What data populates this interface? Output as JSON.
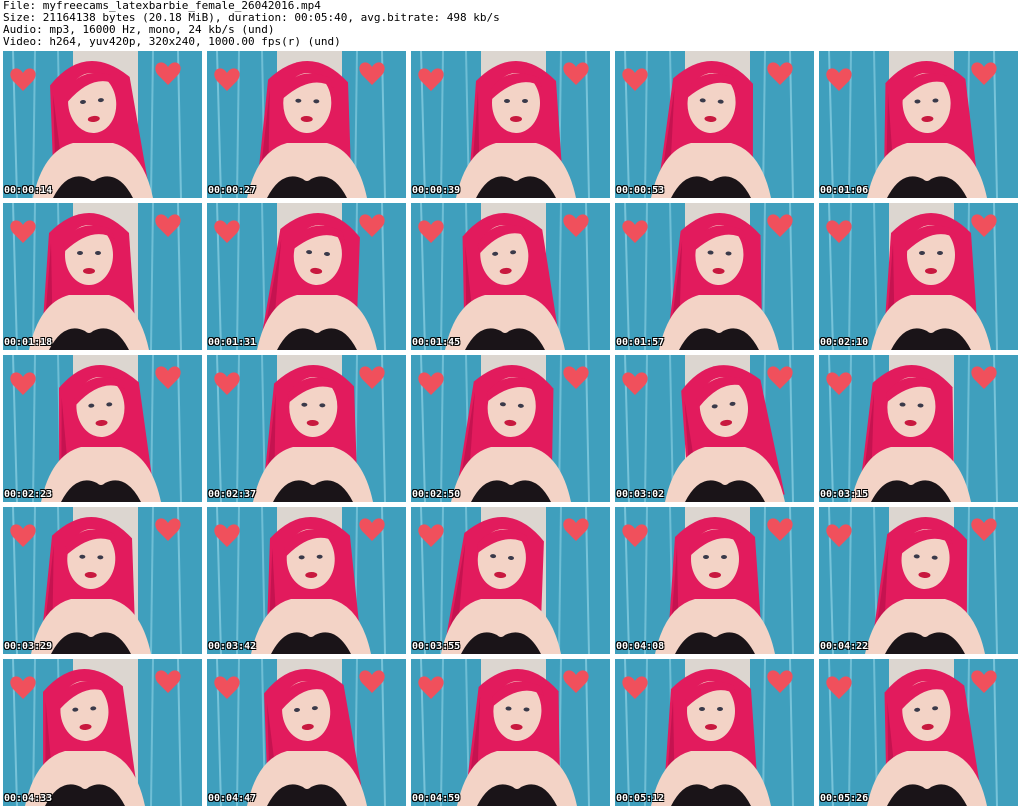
{
  "header": {
    "file_line": "File: myfreecams_latexbarbie_female_26042016.mp4",
    "size_line": "Size: 21164138 bytes (20.18 MiB), duration: 00:05:40, avg.bitrate: 498 kb/s",
    "audio_line": "Audio: mp3, 16000 Hz, mono, 24 kb/s (und)",
    "video_line": "Video: h264, yuv420p, 320x240, 1000.00 fps(r) (und)"
  },
  "thumbnails": [
    {
      "timestamp": "00:00:14"
    },
    {
      "timestamp": "00:00:27"
    },
    {
      "timestamp": "00:00:39"
    },
    {
      "timestamp": "00:00:53"
    },
    {
      "timestamp": "00:01:06"
    },
    {
      "timestamp": "00:01:18"
    },
    {
      "timestamp": "00:01:31"
    },
    {
      "timestamp": "00:01:45"
    },
    {
      "timestamp": "00:01:57"
    },
    {
      "timestamp": "00:02:10"
    },
    {
      "timestamp": "00:02:23"
    },
    {
      "timestamp": "00:02:37"
    },
    {
      "timestamp": "00:02:50"
    },
    {
      "timestamp": "00:03:02"
    },
    {
      "timestamp": "00:03:15"
    },
    {
      "timestamp": "00:03:29"
    },
    {
      "timestamp": "00:03:42"
    },
    {
      "timestamp": "00:03:55"
    },
    {
      "timestamp": "00:04:08"
    },
    {
      "timestamp": "00:04:22"
    },
    {
      "timestamp": "00:04:33"
    },
    {
      "timestamp": "00:04:47"
    },
    {
      "timestamp": "00:04:59"
    },
    {
      "timestamp": "00:05:12"
    },
    {
      "timestamp": "00:05:26"
    }
  ],
  "colors": {
    "curtain": "#3f9fbd",
    "curtain_light": "#8fd3e6",
    "wall": "#dcd6d0",
    "hair": "#e21b5d",
    "hair_dark": "#b30f47",
    "skin": "#f3d3c6",
    "heart": "#f0505c",
    "lingerie": "#1a1418",
    "lips": "#c8193f"
  }
}
